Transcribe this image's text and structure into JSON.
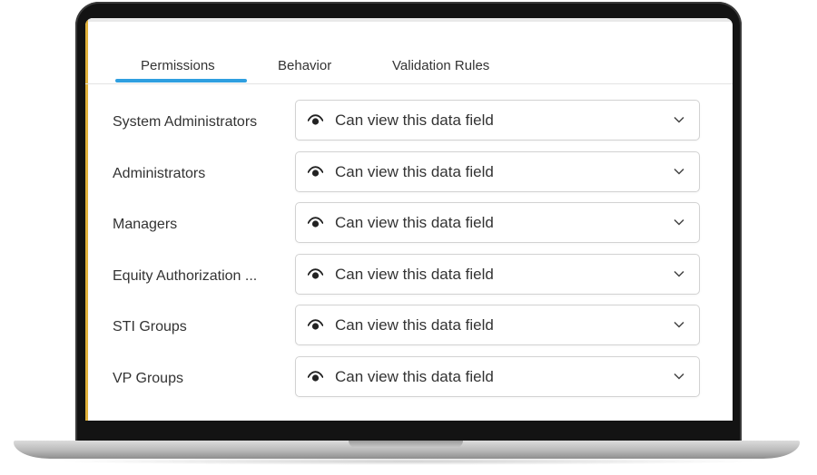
{
  "tabs": [
    {
      "label": "Permissions",
      "active": true
    },
    {
      "label": "Behavior",
      "active": false
    },
    {
      "label": "Validation Rules",
      "active": false
    }
  ],
  "rows": [
    {
      "label": "System Administrators",
      "value": "Can view this data field",
      "icon": "eye-icon"
    },
    {
      "label": "Administrators",
      "value": "Can view this data field",
      "icon": "eye-icon"
    },
    {
      "label": "Managers",
      "value": "Can view this data field",
      "icon": "eye-icon"
    },
    {
      "label": "Equity Authorization ...",
      "value": "Can view this data field",
      "icon": "eye-icon"
    },
    {
      "label": "STI Groups",
      "value": "Can view this data field",
      "icon": "eye-icon"
    },
    {
      "label": "VP Groups",
      "value": "Can view this data field",
      "icon": "eye-icon"
    }
  ],
  "colors": {
    "accent": "#2f9fe0",
    "text": "#333333",
    "border": "#d2d2d2",
    "bezel": "#131313"
  }
}
